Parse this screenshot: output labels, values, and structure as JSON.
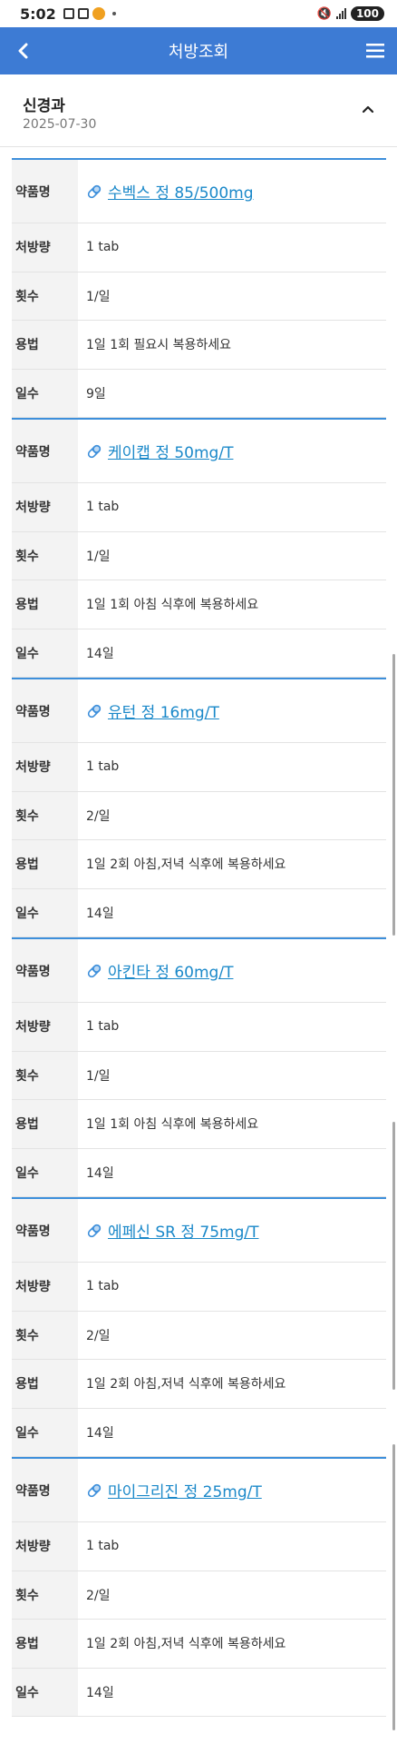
{
  "status_bar": {
    "time": "5:02",
    "battery": "100"
  },
  "header": {
    "title": "처방조회"
  },
  "department": {
    "name": "신경과",
    "date": "2025-07-30"
  },
  "labels": {
    "drug": "약품명",
    "dose": "처방량",
    "frequency": "횟수",
    "usage": "용법",
    "days": "일수"
  },
  "prescriptions": [
    {
      "drug": "수벡스 정 85/500mg",
      "dose": "1 tab",
      "frequency": "1/일",
      "usage": "1일 1회 필요시 복용하세요",
      "days": "9일"
    },
    {
      "drug": "케이캡 정 50mg/T",
      "dose": "1 tab",
      "frequency": "1/일",
      "usage": "1일 1회 아침 식후에 복용하세요",
      "days": "14일"
    },
    {
      "drug": "유턴 정 16mg/T",
      "dose": "1 tab",
      "frequency": "2/일",
      "usage": "1일 2회 아침,저녁 식후에 복용하세요",
      "days": "14일"
    },
    {
      "drug": "아킨타 정 60mg/T",
      "dose": "1 tab",
      "frequency": "1/일",
      "usage": "1일 1회 아침 식후에 복용하세요",
      "days": "14일"
    },
    {
      "drug": "에페신 SR 정 75mg/T",
      "dose": "1 tab",
      "frequency": "2/일",
      "usage": "1일 2회 아침,저녁 식후에 복용하세요",
      "days": "14일"
    },
    {
      "drug": "마이그리진 정 25mg/T",
      "dose": "1 tab",
      "frequency": "2/일",
      "usage": "1일 2회 아침,저녁 식후에 복용하세요",
      "days": "14일"
    }
  ],
  "colors": {
    "header_bg": "#3d7bd4",
    "accent": "#3d8fdb",
    "link": "#1a88c9"
  },
  "icons": {
    "back": "chevron-left-icon",
    "menu": "hamburger-menu-icon",
    "collapse": "chevron-up-icon",
    "drug": "pill-icon"
  }
}
